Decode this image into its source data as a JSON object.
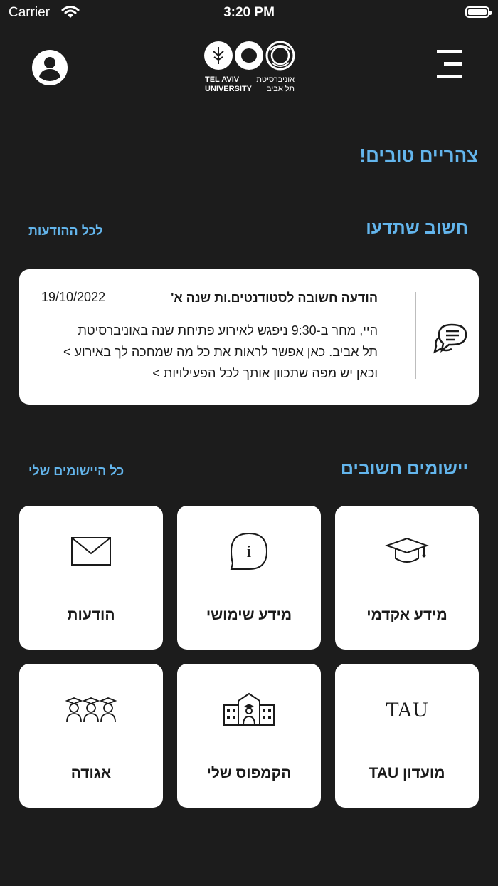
{
  "status_bar": {
    "carrier": "Carrier",
    "time": "3:20 PM"
  },
  "header": {
    "logo_en": [
      "TEL AVIV",
      "UNIVERSITY"
    ],
    "logo_he": [
      "אוניברסיטת",
      "תל אביב"
    ]
  },
  "greeting": "צהריים טובים!",
  "notices_section": {
    "title": "חשוב שתדעו",
    "link": "לכל ההודעות",
    "notice": {
      "title": "הודעה חשובה לסטודנטים.ות שנה א'",
      "date": "19/10/2022",
      "body_lines": [
        "היי, מחר ב-9:30 ניפגש לאירוע פתיחת שנה באוניברסיטת",
        "תל אביב. כאן אפשר לראות את כל מה שמחכה לך באירוע >",
        "וכאן יש מפה שתכוון אותך לכל הפעילויות >"
      ]
    }
  },
  "apps_section": {
    "title": "יישומים חשובים",
    "link": "כל היישומים שלי",
    "tiles": [
      {
        "label": "מידע אקדמי",
        "icon": "graduation-cap-icon"
      },
      {
        "label": "מידע שימושי",
        "icon": "info-bubble-icon"
      },
      {
        "label": "הודעות",
        "icon": "envelope-icon"
      },
      {
        "label": "מועדון TAU",
        "icon": "tau-logo-icon",
        "icon_text": "TAU"
      },
      {
        "label": "הקמפוס שלי",
        "icon": "campus-building-icon"
      },
      {
        "label": "אגודה",
        "icon": "students-group-icon"
      }
    ]
  },
  "colors": {
    "background": "#1c1c1c",
    "accent": "#63b5ec",
    "card": "#ffffff",
    "text_dark": "#1a1a1a"
  }
}
